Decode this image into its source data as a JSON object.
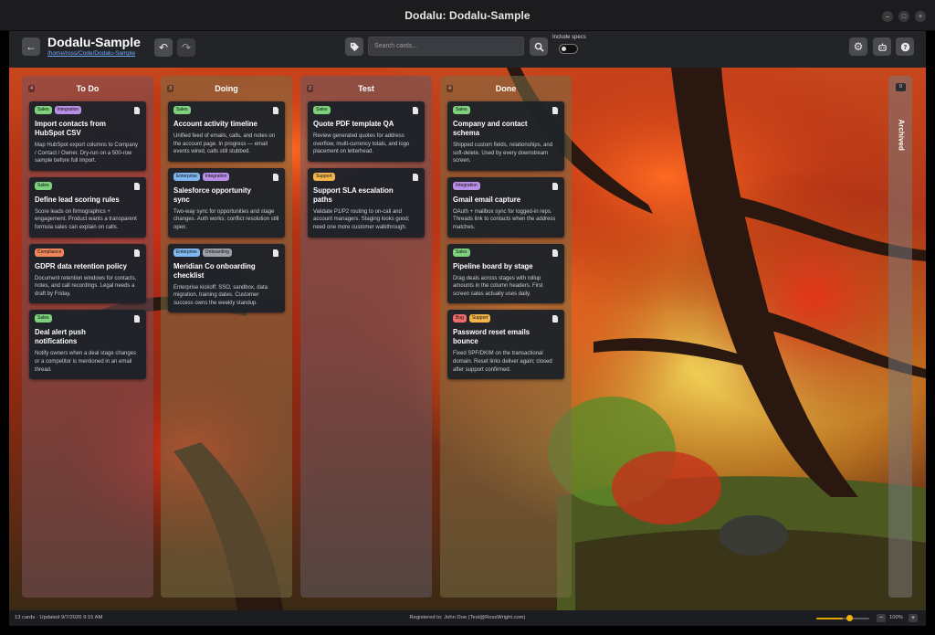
{
  "window": {
    "title": "Dodalu: Dodalu-Sample"
  },
  "header": {
    "project_title": "Dodalu-Sample",
    "project_path": "/home/ross/Code/Dodalu-Sample",
    "search_placeholder": "Search cards...",
    "include_specs_label": "Include specs",
    "include_specs_on": false
  },
  "tag_colors": {
    "Sales": "#7dd17d",
    "Integration": "#b98ee6",
    "Compliance": "#f0875a",
    "Enterprise": "#7fb6f0",
    "Onboarding": "#9aa0a6",
    "Support": "#f3b54a",
    "Bug": "#ef6b6b"
  },
  "columns": [
    {
      "name": "To Do",
      "count": "4",
      "cards": [
        {
          "tags": [
            "Sales",
            "Integration"
          ],
          "title": "Import contacts from HubSpot CSV",
          "desc": "Map HubSpot export columns to Company / Contact / Owner. Dry-run on a 500-row sample before full import."
        },
        {
          "tags": [
            "Sales"
          ],
          "title": "Define lead scoring rules",
          "desc": "Score leads on firmographics + engagement. Product wants a transparent formula sales can explain on calls."
        },
        {
          "tags": [
            "Compliance"
          ],
          "title": "GDPR data retention policy",
          "desc": "Document retention windows for contacts, notes, and call recordings. Legal needs a draft by Friday."
        },
        {
          "tags": [
            "Sales"
          ],
          "title": "Deal alert push notifications",
          "desc": "Notify owners when a deal stage changes or a competitor is mentioned in an email thread."
        }
      ]
    },
    {
      "name": "Doing",
      "count": "3",
      "cards": [
        {
          "tags": [
            "Sales"
          ],
          "title": "Account activity timeline",
          "desc": "Unified feed of emails, calls, and notes on the account page. In progress — email events wired, calls still stubbed."
        },
        {
          "tags": [
            "Enterprise",
            "Integration"
          ],
          "title": "Salesforce opportunity sync",
          "desc": "Two-way sync for opportunities and stage changes. Auth works; conflict resolution still open."
        },
        {
          "tags": [
            "Enterprise",
            "Onboarding"
          ],
          "title": "Meridian Co onboarding checklist",
          "desc": "Enterprise kickoff: SSO, sandbox, data migration, training dates. Customer success owns the weekly standup."
        }
      ]
    },
    {
      "name": "Test",
      "count": "2",
      "cards": [
        {
          "tags": [
            "Sales"
          ],
          "title": "Quote PDF template QA",
          "desc": "Review generated quotes for address overflow, multi-currency totals, and logo placement on letterhead."
        },
        {
          "tags": [
            "Support"
          ],
          "title": "Support SLA escalation paths",
          "desc": "Validate P1/P2 routing to on-call and account managers. Staging looks good; need one more customer walkthrough."
        }
      ]
    },
    {
      "name": "Done",
      "count": "4",
      "cards": [
        {
          "tags": [
            "Sales"
          ],
          "title": "Company and contact schema",
          "desc": "Shipped custom fields, relationships, and soft-delete. Used by every downstream screen."
        },
        {
          "tags": [
            "Integration"
          ],
          "title": "Gmail email capture",
          "desc": "OAuth + mailbox sync for logged-in reps. Threads link to contacts when the address matches."
        },
        {
          "tags": [
            "Sales"
          ],
          "title": "Pipeline board by stage",
          "desc": "Drag deals across stages with rollup amounts in the column headers. First screen sales actually uses daily."
        },
        {
          "tags": [
            "Bug",
            "Support"
          ],
          "title": "Password reset emails bounce",
          "desc": "Fixed SPF/DKIM on the transactional domain. Reset links deliver again; closed after support confirmed."
        }
      ]
    }
  ],
  "archived": {
    "label": "Archived",
    "count": "0"
  },
  "status": {
    "summary": "13 cards · Updated 9/7/2026 9:15 AM",
    "registered": "Registered to: John Doe (Test@RossWright.com)",
    "zoom_label": "100%",
    "zoom_fraction": 0.5
  }
}
